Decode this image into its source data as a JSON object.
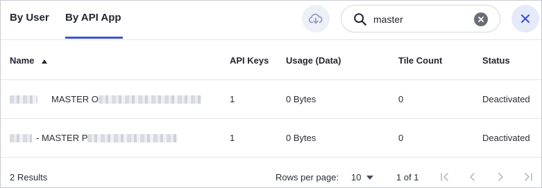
{
  "tabs": {
    "by_user": "By User",
    "by_api_app": "By API App",
    "active": "By API App"
  },
  "search": {
    "value": "master",
    "placeholder": ""
  },
  "icons": {
    "cloud_download": "cloud-download-icon",
    "search": "search-icon",
    "clear": "clear-icon",
    "close": "close-icon",
    "sort_ascending": "sort-asc-icon"
  },
  "colors": {
    "accent": "#3b51d8",
    "close_bg": "#e6e9f7",
    "cloud_bg": "#eef0f7"
  },
  "table": {
    "headers": {
      "name": "Name",
      "api_keys": "API Keys",
      "usage": "Usage (Data)",
      "tile_count": "Tile Count",
      "status": "Status"
    },
    "rows": [
      {
        "name_visible": "MASTER O",
        "api_keys": "1",
        "usage": "0 Bytes",
        "tile_count": "0",
        "status": "Deactivated"
      },
      {
        "name_visible": "- MASTER P",
        "api_keys": "1",
        "usage": "0 Bytes",
        "tile_count": "0",
        "status": "Deactivated"
      }
    ]
  },
  "footer": {
    "results": "2 Results",
    "rows_per_page_label": "Rows per page:",
    "rows_per_page_value": "10",
    "page_info": "1 of 1"
  }
}
